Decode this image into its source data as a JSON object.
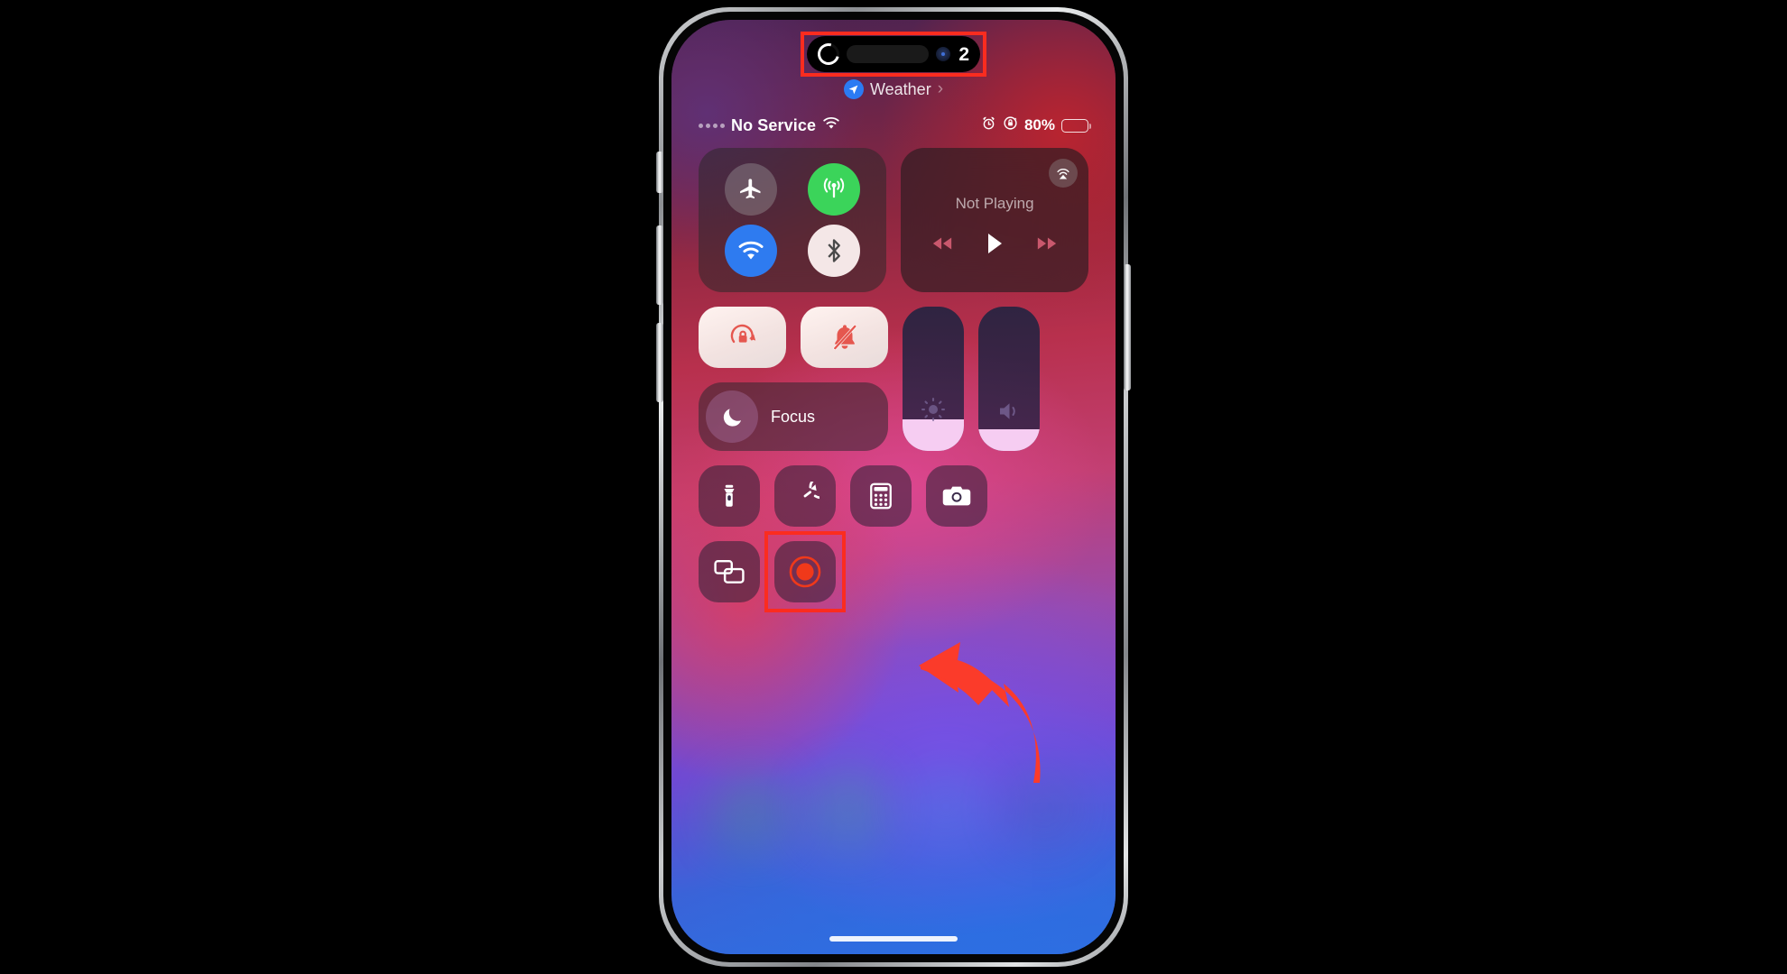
{
  "device": {
    "name": "iphone-15-pro",
    "side_buttons": [
      "action-button",
      "volume-up-button",
      "volume-down-button",
      "power-button"
    ]
  },
  "dynamic_island": {
    "timer_ring_icon": "timer-ring-icon",
    "camera_indicator_icon": "camera-dot-icon",
    "count": "2",
    "highlighted": true,
    "highlight_color": "#fb2c1f"
  },
  "weather_banner": {
    "location_icon": "location-arrow-icon",
    "label": "Weather",
    "chevron": "›"
  },
  "status_bar": {
    "signal_icon": "signal-dots-icon",
    "carrier": "No Service",
    "wifi_icon": "wifi-icon",
    "alarm_icon": "alarm-clock-icon",
    "rotation_lock_icon": "rotation-lock-icon",
    "battery_percent": "80%",
    "battery_fill_pct": 80,
    "battery_icon": "battery-icon"
  },
  "control_center": {
    "connectivity": {
      "airplane": {
        "name": "airplane-mode-toggle",
        "icon": "airplane-icon",
        "state": "off"
      },
      "cellular": {
        "name": "cellular-data-toggle",
        "icon": "cellular-antenna-icon",
        "state": "on",
        "color": "#3bd45a"
      },
      "wifi": {
        "name": "wifi-toggle",
        "icon": "wifi-icon",
        "state": "on",
        "color": "#2e7bf0"
      },
      "bluetooth": {
        "name": "bluetooth-toggle",
        "icon": "bluetooth-icon",
        "state": "on",
        "color": "#f4e7e7"
      }
    },
    "media": {
      "title": "Not Playing",
      "airplay_icon": "airplay-icon",
      "rewind_icon": "rewind-icon",
      "play_icon": "play-icon",
      "forward_icon": "fast-forward-icon"
    },
    "rotation_lock": {
      "name": "rotation-lock-toggle",
      "icon": "rotation-lock-icon",
      "state": "on"
    },
    "silent_mode": {
      "name": "silent-mode-toggle",
      "icon": "bell-slash-icon",
      "state": "on"
    },
    "focus": {
      "label": "Focus",
      "icon": "moon-icon"
    },
    "brightness_slider": {
      "name": "brightness-slider",
      "icon": "brightness-sun-icon",
      "value_pct": 22
    },
    "volume_slider": {
      "name": "volume-slider",
      "icon": "speaker-icon",
      "value_pct": 15
    },
    "utilities": [
      {
        "name": "flashlight-button",
        "icon": "flashlight-icon"
      },
      {
        "name": "timer-button",
        "icon": "timer-icon"
      },
      {
        "name": "calculator-button",
        "icon": "calculator-icon"
      },
      {
        "name": "camera-button",
        "icon": "camera-icon"
      }
    ],
    "screen_mirroring": {
      "name": "screen-mirroring-button",
      "icon": "screen-mirroring-icon"
    },
    "screen_recording": {
      "name": "screen-recording-button",
      "icon": "record-circle-icon",
      "state": "recording",
      "color": "#f0391a",
      "highlighted": true,
      "highlight_color": "#fb2c1f"
    }
  },
  "annotations": {
    "arrow": {
      "name": "callout-arrow",
      "color": "#fb3b2a",
      "direction": "left",
      "points_at": "screen-recording-button"
    }
  },
  "home_indicator": {
    "name": "home-indicator"
  }
}
